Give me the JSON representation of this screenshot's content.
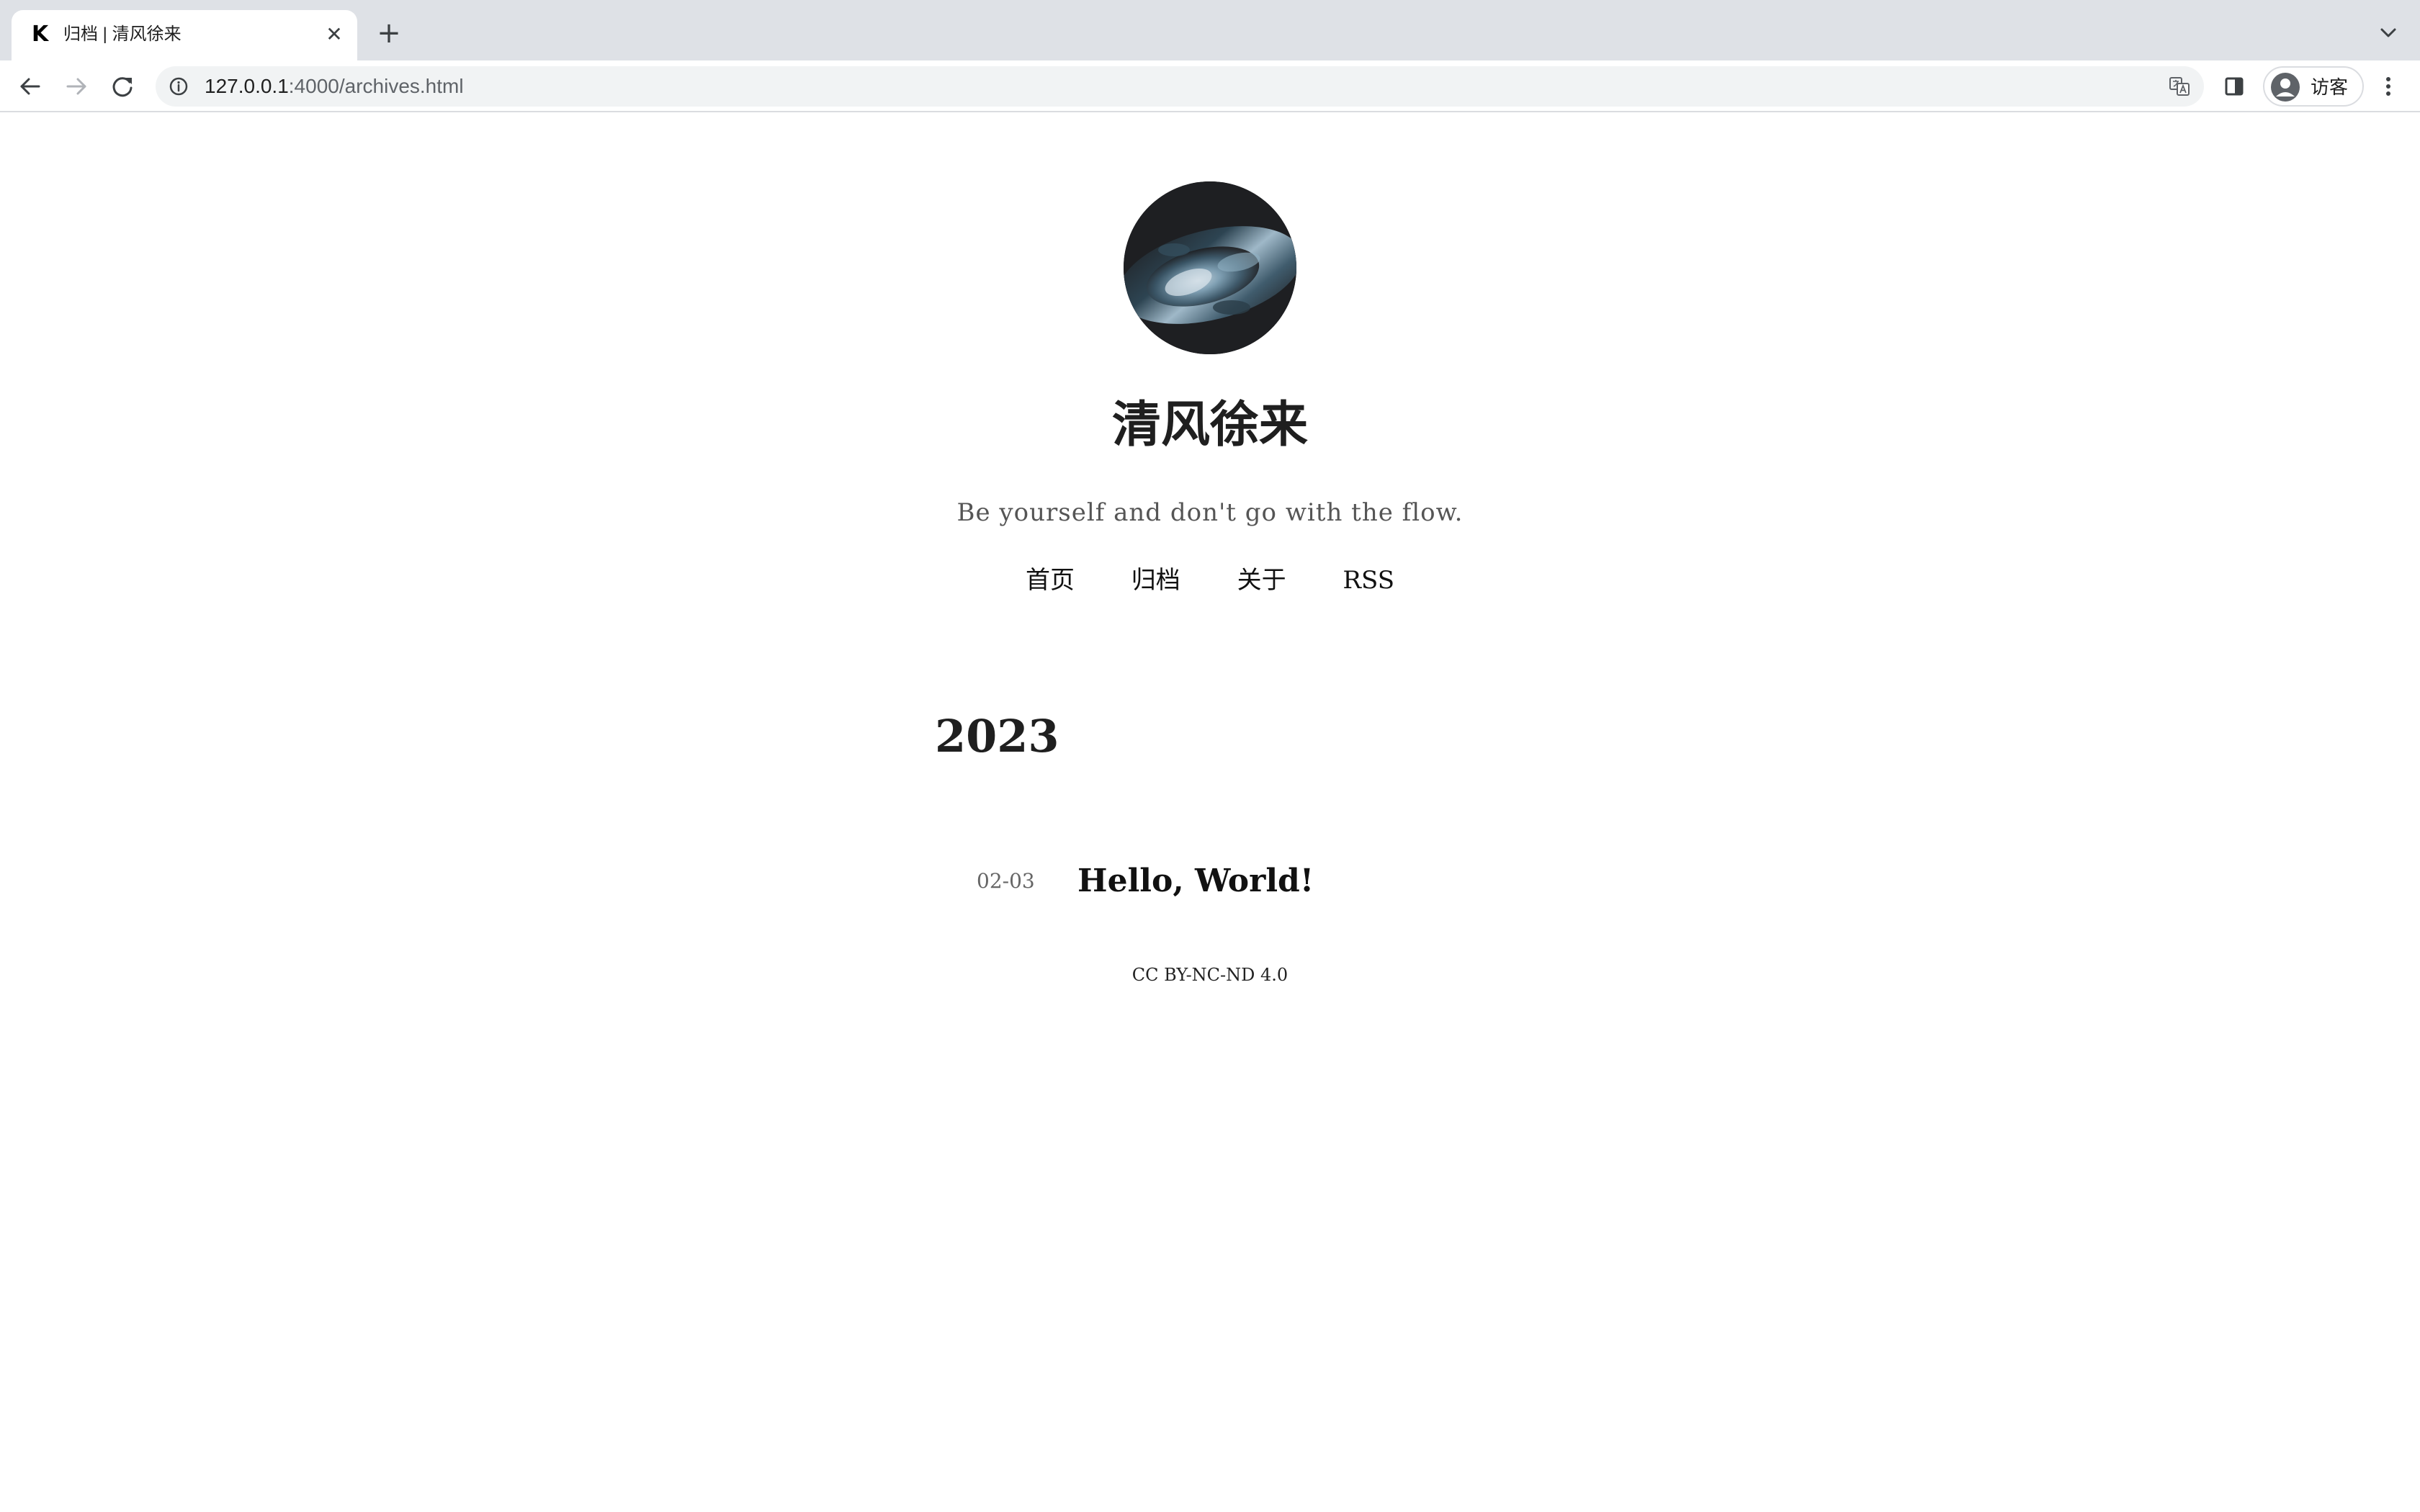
{
  "browser": {
    "tab": {
      "title": "归档 | 清风徐来",
      "favicon_glyph": "K",
      "close_glyph": "✕"
    },
    "new_tab_glyph": "+",
    "address_bar": {
      "host": "127.0.0.1",
      "rest": ":4000/archives.html"
    },
    "profile": {
      "label": "访客"
    }
  },
  "site": {
    "title": "清风徐来",
    "subtitle": "Be yourself and don't go with the flow.",
    "nav": [
      {
        "label": "首页"
      },
      {
        "label": "归档"
      },
      {
        "label": "关于"
      },
      {
        "label": "RSS"
      }
    ]
  },
  "archive": {
    "year": "2023",
    "posts": [
      {
        "date": "02-03",
        "title": "Hello, World!"
      }
    ]
  },
  "footer": {
    "license": "CC BY-NC-ND 4.0"
  },
  "icons": {
    "back": "arrow-left-icon",
    "forward": "arrow-right-icon",
    "reload": "reload-icon",
    "info": "info-icon",
    "translate": "translate-icon",
    "side_panel": "side-panel-icon",
    "profile": "profile-icon",
    "menu": "kebab-menu-icon",
    "tab_search": "chevron-down-icon"
  }
}
